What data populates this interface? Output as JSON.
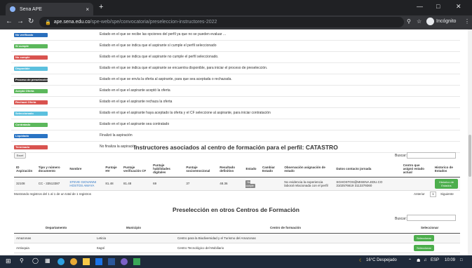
{
  "browser": {
    "tab_title": "Sena APE",
    "tab_close": "×",
    "new_tab": "+",
    "url_host": "ape.sena.edu.co",
    "url_path": "/spe-web/spe/convocatoria/preseleccion-instructores-2022",
    "incognito_label": "Incógnito"
  },
  "legend": [
    {
      "badge": "No verificado",
      "color": "#2a6fbd",
      "desc": "Estado en el que se recibe las opciones del perfil ya que no se pueden evaluar ..."
    },
    {
      "badge": "Si cumple",
      "color": "#5cb85c",
      "desc": "Estado en el que se indica que el aspirante sí cumple el perfil seleccionado"
    },
    {
      "badge": "No cumple",
      "color": "#d9534f",
      "desc": "Estado en el que se indica que el aspirante no cumple el perfil seleccionado."
    },
    {
      "badge": "Disponible",
      "color": "#5bc0de",
      "desc": "Estado en el que se indica que el aspirante se encuentra disponible, para iniciar el proceso de preselección."
    },
    {
      "badge": "Proceso de preselección",
      "color": "#333333",
      "desc": "Estado en el que se envía la oferta al aspirante, para que sea aceptada o rechazada."
    },
    {
      "badge": "Aceptó Oferta",
      "color": "#5cb85c",
      "desc": "Estado en el que el aspirante aceptó la oferta"
    },
    {
      "badge": "Rechazó Oferta",
      "color": "#d9534f",
      "desc": "Estado en el que el aspirante rechaza la oferta"
    },
    {
      "badge": "Seleccionado",
      "color": "#5bc0de",
      "desc": "Estado en el que el aspirante haya aceptado la oferta y el CF seleccione al aspirante, para iniciar contratación"
    },
    {
      "badge": "Contratado",
      "color": "#5cb85c",
      "desc": "Estado en el que el aspirante sea contratado"
    },
    {
      "badge": "Liquidado",
      "color": "#2a74c4",
      "desc": "Finalizó la aspiración"
    },
    {
      "badge": "Terminado",
      "color": "#d9534f",
      "desc": "No finaliza la aspiración"
    }
  ],
  "section1": {
    "title": "Instructores asociados al centro de formación para el perfil: CATASTRO",
    "excel_button": "Excel",
    "search_label": "Buscar:",
    "headers": [
      "ID Aspiración",
      "Tipo y número documento",
      "Nombre",
      "Puntaje HV",
      "Puntaje verificación CF",
      "Puntaje habilidades digitales",
      "Puntaje socioemocional",
      "Resultado definitivo",
      "Estado",
      "Cambiar Estado",
      "Observación asignación de estado",
      "Datos contacto jornada",
      "Centro que asignó estado actual",
      "Historico de Estados"
    ],
    "row": {
      "id": "32108",
      "doc": "CC - 33513387",
      "name": "STEVE GIOVANNI HOSTOS AMAYA",
      "hv": "81.48",
      "verif": "81.48",
      "habilidades": "69",
      "socio": "37",
      "resultado": "48.36",
      "estado": "No cumple",
      "cambiar": "",
      "observacion": "No evidencia la experiencia laboral relacionada con el perfil",
      "contacto": "SGHOSTOS@MISENA.EDU.CO 3102576619 3113379360",
      "centro": "",
      "historico_btn": "Historico de Estados"
    },
    "info": "Mostrando registros del 1 al 1 de un total de 1 registros",
    "prev": "Anterior",
    "page": "1",
    "next": "Siguiente"
  },
  "section2": {
    "title": "Preselección en otros Centros de Formación",
    "search_label": "Buscar:",
    "headers": [
      "Departamento",
      "Municipio",
      "Centro de formación",
      "Seleccionar"
    ],
    "rows": [
      {
        "dep": "Amazonas",
        "mun": "Leticia",
        "centro": "Centro para la Biodiversidad y el Turismo del Amazonas",
        "btn": "Seleccionar"
      },
      {
        "dep": "Antioquia",
        "mun": "Itagüí",
        "centro": "Centro Tecnológico del Mobiliario",
        "btn": "Seleccionar"
      }
    ]
  },
  "taskbar": {
    "weather": "16°C Despejado",
    "lang": "ESP",
    "time": "10:09"
  }
}
